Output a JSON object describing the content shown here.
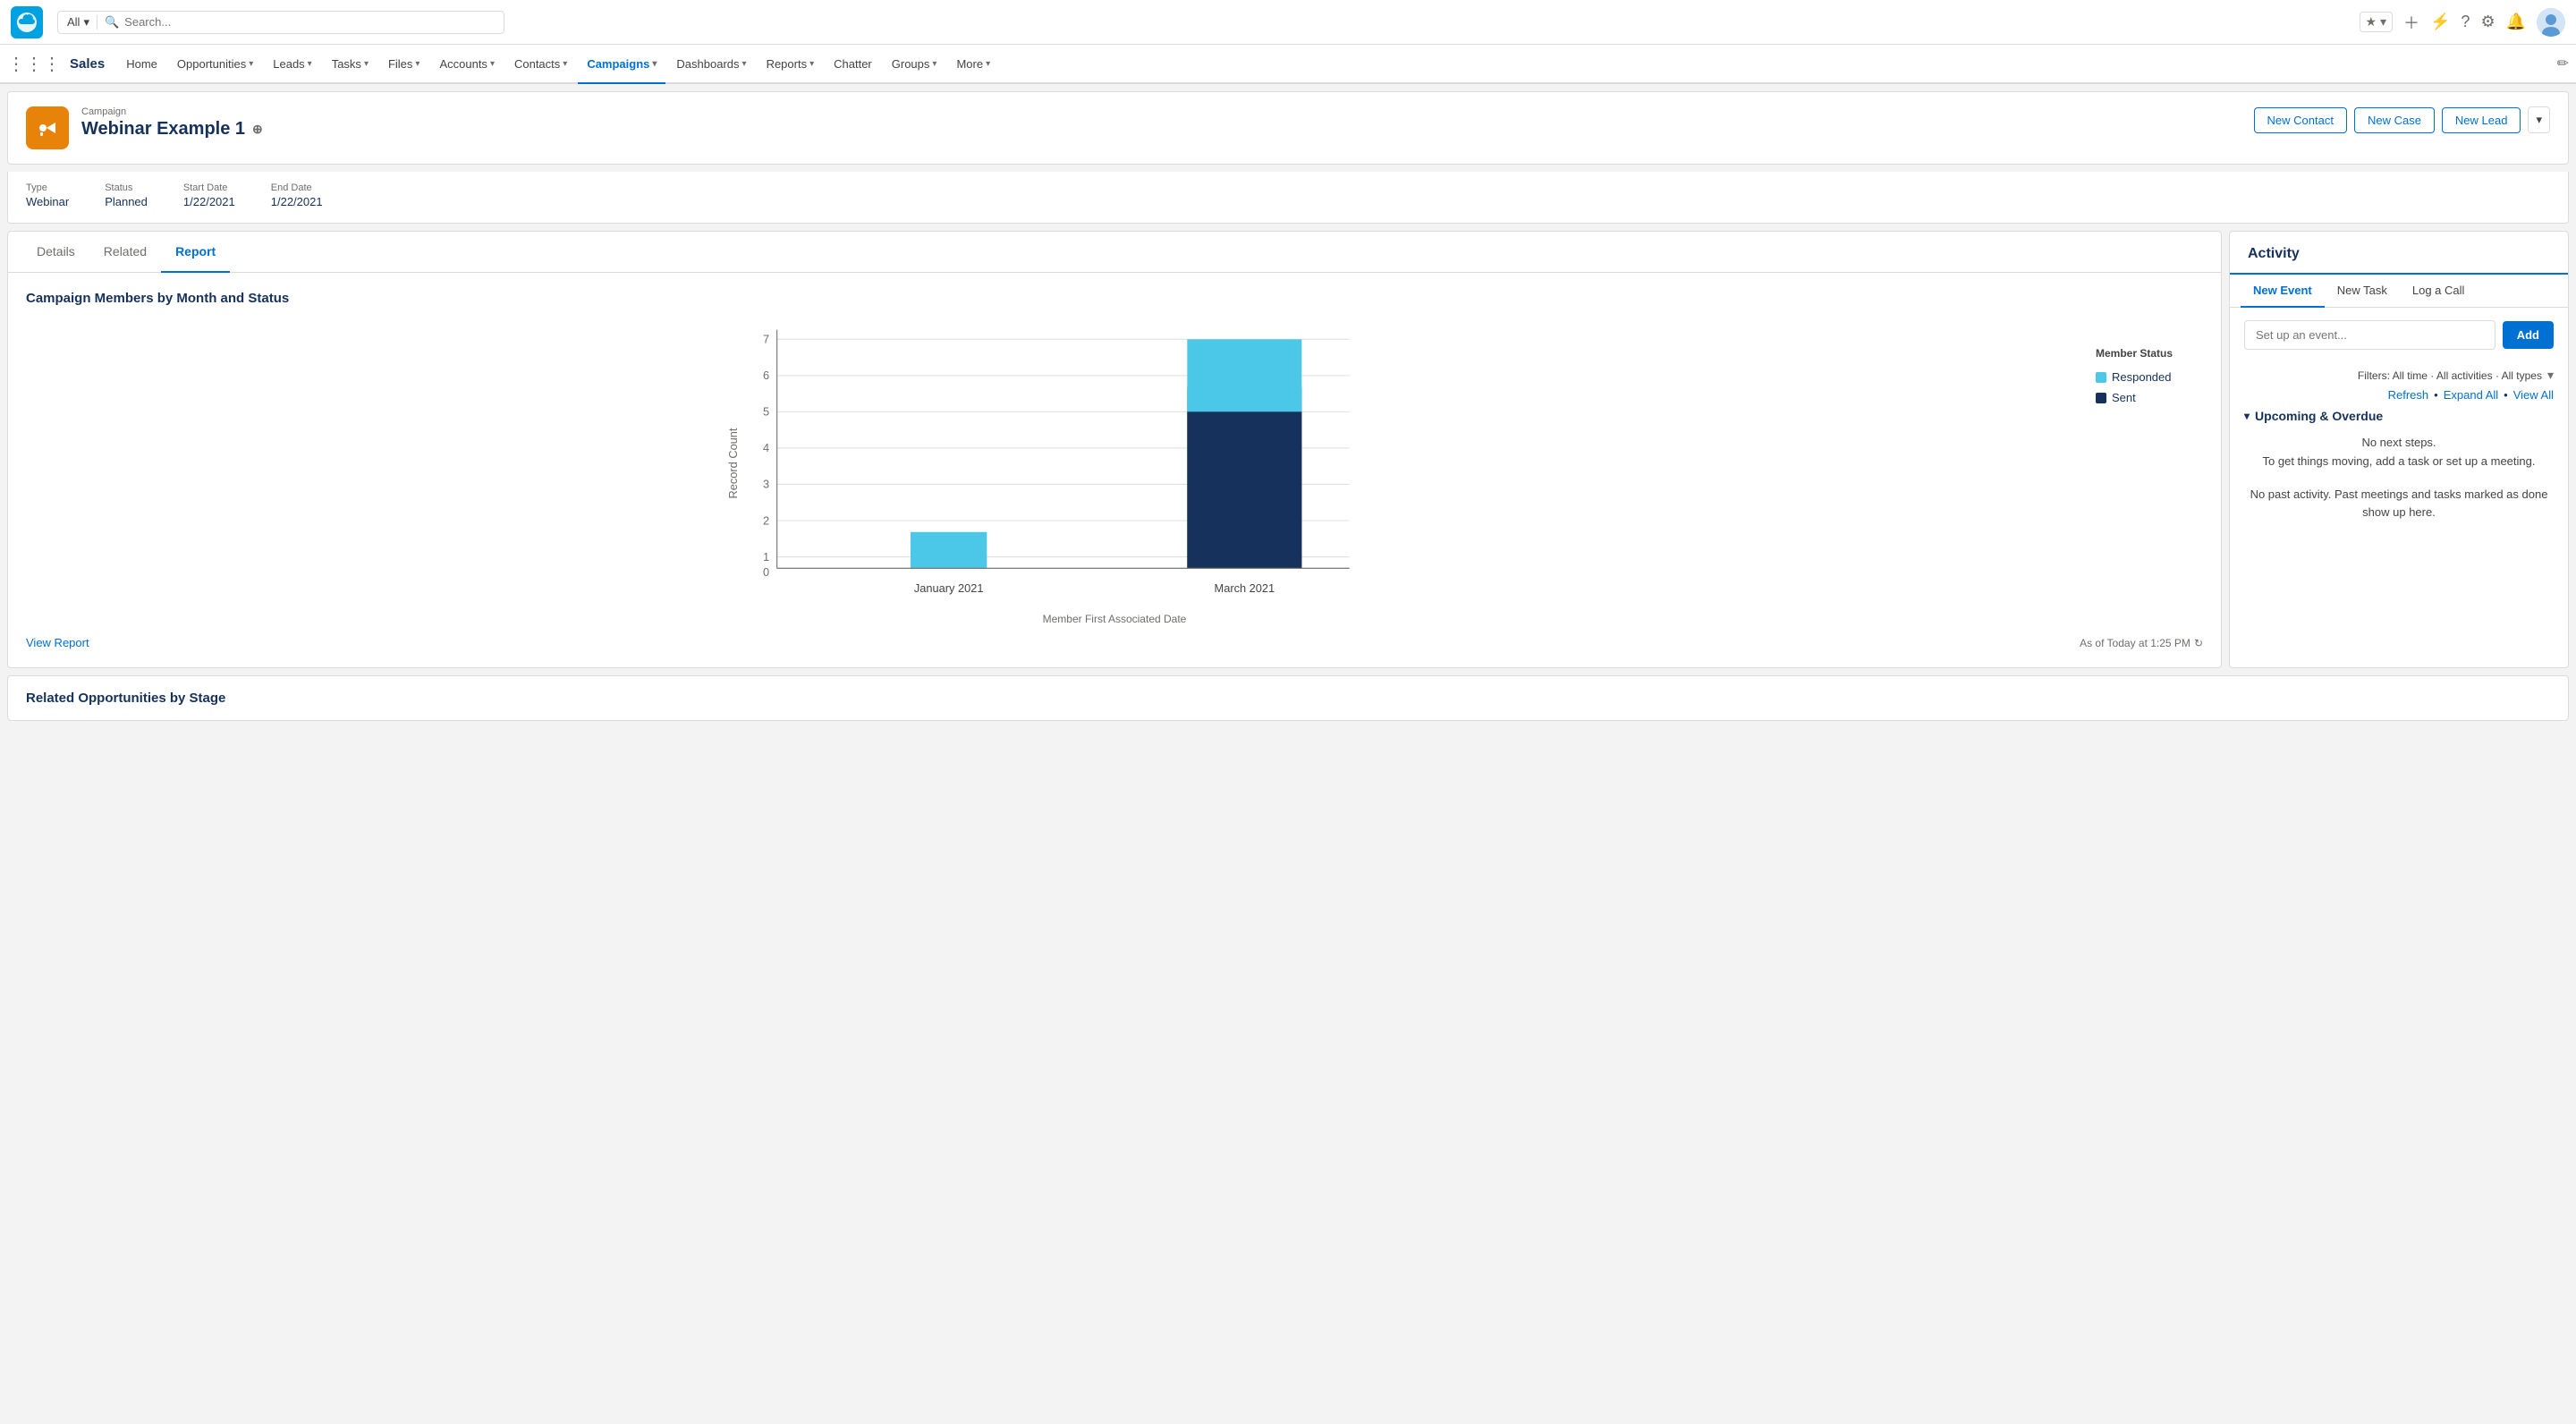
{
  "topbar": {
    "logo_letter": "☁",
    "search_scope": "All",
    "search_placeholder": "Search...",
    "icons": [
      "★",
      "+",
      "⚡",
      "?",
      "⚙",
      "🔔"
    ]
  },
  "navbar": {
    "app_name": "Sales",
    "items": [
      {
        "label": "Home",
        "has_dropdown": false,
        "active": false
      },
      {
        "label": "Opportunities",
        "has_dropdown": true,
        "active": false
      },
      {
        "label": "Leads",
        "has_dropdown": true,
        "active": false
      },
      {
        "label": "Tasks",
        "has_dropdown": true,
        "active": false
      },
      {
        "label": "Files",
        "has_dropdown": true,
        "active": false
      },
      {
        "label": "Accounts",
        "has_dropdown": true,
        "active": false
      },
      {
        "label": "Contacts",
        "has_dropdown": true,
        "active": false
      },
      {
        "label": "Campaigns",
        "has_dropdown": true,
        "active": true
      },
      {
        "label": "Dashboards",
        "has_dropdown": true,
        "active": false
      },
      {
        "label": "Reports",
        "has_dropdown": true,
        "active": false
      },
      {
        "label": "Chatter",
        "has_dropdown": false,
        "active": false
      },
      {
        "label": "Groups",
        "has_dropdown": true,
        "active": false
      },
      {
        "label": "More",
        "has_dropdown": true,
        "active": false
      }
    ]
  },
  "record": {
    "type": "Campaign",
    "title": "Webinar Example 1",
    "fields": {
      "type_label": "Type",
      "type_value": "Webinar",
      "status_label": "Status",
      "status_value": "Planned",
      "start_date_label": "Start Date",
      "start_date_value": "1/22/2021",
      "end_date_label": "End Date",
      "end_date_value": "1/22/2021"
    },
    "actions": {
      "new_contact": "New Contact",
      "new_case": "New Case",
      "new_lead": "New Lead"
    }
  },
  "tabs": {
    "items": [
      {
        "label": "Details",
        "active": false
      },
      {
        "label": "Related",
        "active": false
      },
      {
        "label": "Report",
        "active": true
      }
    ]
  },
  "chart": {
    "title": "Campaign Members by Month and Status",
    "y_axis_label": "Record Count",
    "x_axis_label": "Member First Associated Date",
    "y_ticks": [
      "0",
      "1",
      "2",
      "3",
      "4",
      "5",
      "6",
      "7"
    ],
    "bars": [
      {
        "month": "January 2021",
        "responded": 1,
        "sent": 0,
        "total": 1
      },
      {
        "month": "March 2021",
        "responded": 2,
        "sent": 5,
        "total": 7
      }
    ],
    "legend": {
      "responded_label": "Responded",
      "responded_color": "#4bc8e8",
      "sent_label": "Sent",
      "sent_color": "#16325c"
    },
    "footer": {
      "view_report": "View Report",
      "timestamp": "As of Today at 1:25 PM"
    }
  },
  "activity": {
    "title": "Activity",
    "tabs": [
      {
        "label": "New Event",
        "active": true
      },
      {
        "label": "New Task",
        "active": false
      },
      {
        "label": "Log a Call",
        "active": false
      }
    ],
    "event_placeholder": "Set up an event...",
    "add_button": "Add",
    "filters_text": "Filters: All time · All activities · All types",
    "links": [
      "Refresh",
      "Expand All",
      "View All"
    ],
    "upcoming_header": "Upcoming & Overdue",
    "no_steps": "No next steps.",
    "no_steps_sub": "To get things moving, add a task or set up a meeting.",
    "past_activity": "No past activity. Past meetings and tasks marked as done show up here."
  },
  "bottom": {
    "title": "Related Opportunities by Stage"
  }
}
